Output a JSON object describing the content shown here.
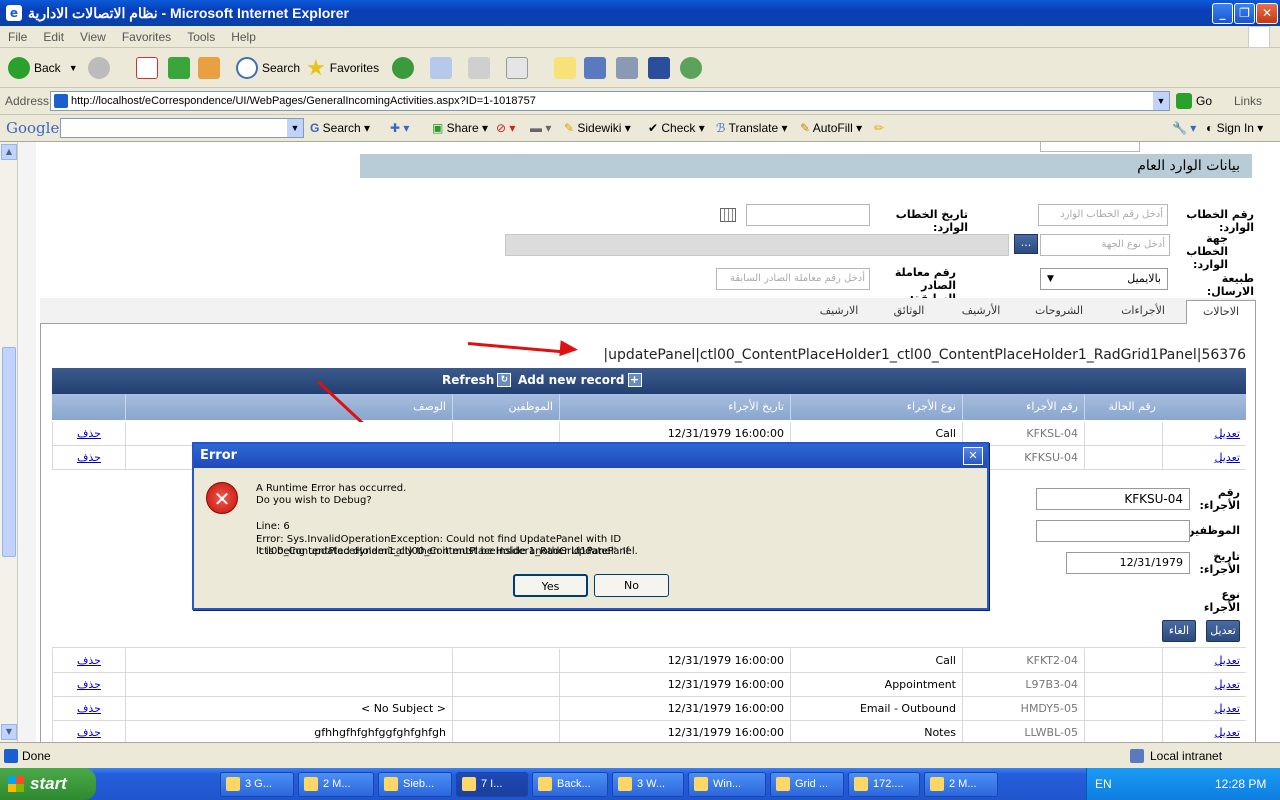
{
  "window": {
    "title": "نظام الاتصالات الادارية - Microsoft Internet Explorer"
  },
  "menu": [
    "File",
    "Edit",
    "View",
    "Favorites",
    "Tools",
    "Help"
  ],
  "toolbar": {
    "back": "Back",
    "search": "Search",
    "favorites": "Favorites"
  },
  "address": {
    "label": "Address",
    "url": "http://localhost/eCorrespondence/UI/WebPages/GeneralIncomingActivities.aspx?ID=1-1018757",
    "go": "Go",
    "links": "Links"
  },
  "google": {
    "logo": "Google",
    "search": "Search",
    "share": "Share",
    "sidewiki": "Sidewiki",
    "check": "Check",
    "translate": "Translate",
    "autofill": "AutoFill",
    "signin": "Sign In"
  },
  "page": {
    "section_title": "بيانات الوارد العام",
    "fields": {
      "incoming_no_label": "رقم الخطاب الوارد:",
      "incoming_no_placeholder": "أدخل رقم الخطاب الوارد",
      "incoming_date_label": "تاريخ الخطاب الوارد:",
      "sender_label": "جهة الخطاب الوارد:",
      "sender_placeholder": "أدخل نوع الجهة",
      "browse_btn": "...",
      "send_type_label": "طبيعة الارسال:",
      "send_type_value": "بالايميل",
      "prev_outgoing_label": "رقم معاملة الصادر السابقة:",
      "prev_outgoing_placeholder": "أدخل رقم معاملة الصادر السابقة"
    },
    "tabs": [
      "الاحالات",
      "الأجراءات",
      "الشروحات",
      "الأرشيف",
      "الوثائق",
      "الارشيف"
    ],
    "panel_message": "|updatePanel|ctl00_ContentPlaceHolder1_ctl00_ContentPlaceHolder1_RadGrid1Panel|56376",
    "grid": {
      "refresh": "Refresh",
      "add_new": "Add new record",
      "headers": [
        "رقم الحالة",
        "رقم الأجراء",
        "نوع الأجراء",
        "تاريخ الأجراء",
        "الموظفين",
        "الوصف"
      ],
      "edit_link": "تعديل",
      "delete_link": "حذف",
      "rows_top": [
        {
          "case": "",
          "id": "KFKSL-04",
          "type": "Call",
          "date": "12/31/1979 16:00:00",
          "emp": "",
          "desc": ""
        },
        {
          "case": "",
          "id": "KFKSU-04",
          "type": "",
          "date": "",
          "emp": "",
          "desc": ""
        }
      ],
      "rows_bottom": [
        {
          "case": "",
          "id": "KFKT2-04",
          "type": "Call",
          "date": "12/31/1979 16:00:00",
          "emp": "",
          "desc": ""
        },
        {
          "case": "",
          "id": "L97B3-04",
          "type": "Appointment",
          "date": "12/31/1979 16:00:00",
          "emp": "",
          "desc": ""
        },
        {
          "case": "",
          "id": "HMDY5-05",
          "type": "Email - Outbound",
          "date": "12/31/1979 16:00:00",
          "emp": "",
          "desc": "< No Subject >"
        },
        {
          "case": "",
          "id": "LLWBL-05",
          "type": "Notes",
          "date": "12/31/1979 16:00:00",
          "emp": "",
          "desc": "gfhhgfhfghfggfghfghfgh"
        }
      ],
      "edit_form": {
        "action_no_label": "رقم الأجراء:",
        "action_no_value": "KFKSU-04",
        "employees_label": "الموظفين:",
        "date_label": "تاريخ الأجراء:",
        "date_value": "12/31/1979",
        "type_label": "نوع الأجراء",
        "update_btn": "تعديل",
        "cancel_btn": "الغاء"
      }
    }
  },
  "dialog": {
    "title": "Error",
    "line1": "A Runtime Error has occurred.",
    "line2": "Do you wish to Debug?",
    "line3": "Line: 6",
    "line4": "Error: Sys.InvalidOperationException: Could not find UpdatePanel with ID 'ctl00_ContentPlaceHolder1_ctl00_ContentPlaceHolder1_RadGrid1Panel'. If",
    "line5": "it is being updated dynamically then it must be inside another UpdatePanel.",
    "yes": "Yes",
    "no": "No"
  },
  "status": {
    "text": "Done",
    "zone": "Local intranet"
  },
  "taskbar": {
    "start": "start",
    "tasks": [
      "3 G...",
      "2 M...",
      "Sieb...",
      "7 I...",
      "Back...",
      "3 W...",
      "Win...",
      "Grid ...",
      "172....",
      "2 M..."
    ],
    "lang": "EN",
    "time": "12:28 PM"
  }
}
